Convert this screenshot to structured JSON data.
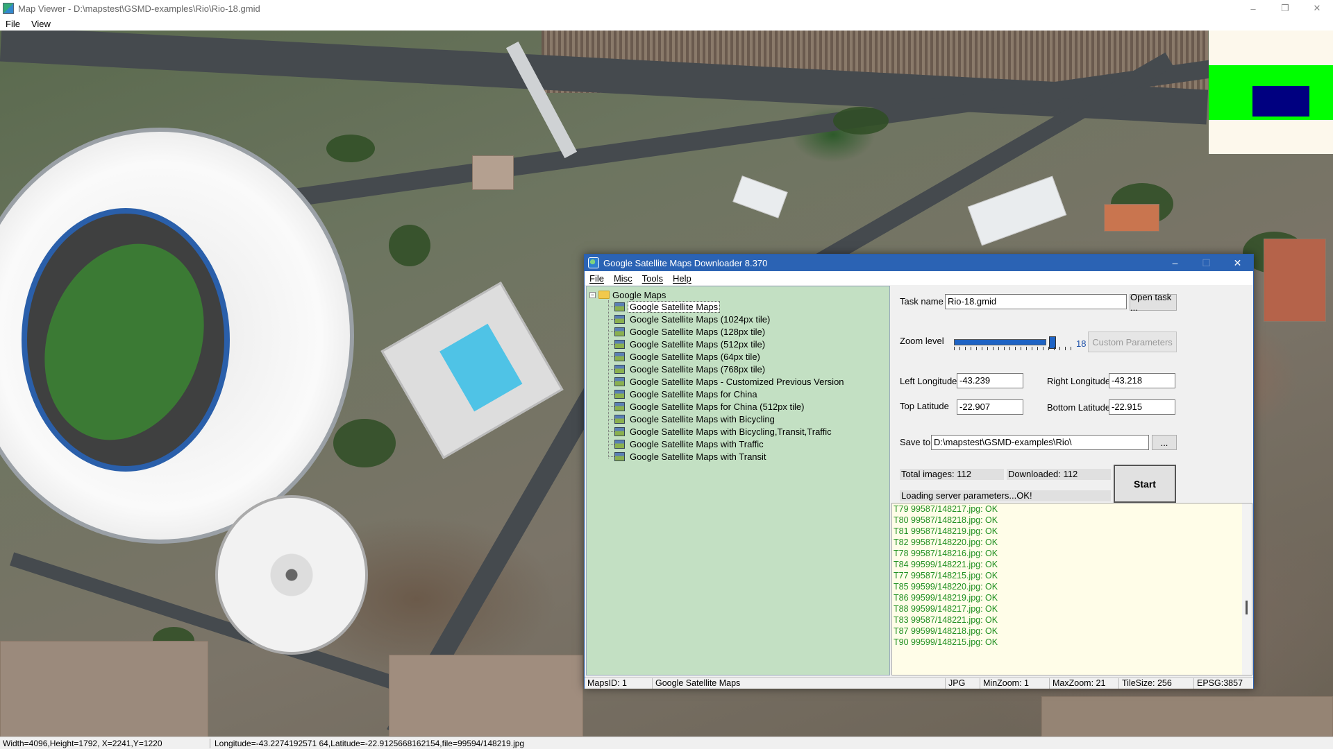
{
  "map_viewer": {
    "title": "Map Viewer - D:\\mapstest\\GSMD-examples\\Rio\\Rio-18.gmid",
    "menu": [
      "File",
      "View"
    ],
    "window_buttons": [
      "–",
      "❐",
      "✕"
    ],
    "status": {
      "dims": "Width=4096,Height=1792, X=2241,Y=1220",
      "coords": "Longitude=-43.2274192571 64,Latitude=-22.9125668162154,file=99594/148219.jpg"
    }
  },
  "downloader": {
    "title": "Google Satellite Maps Downloader 8.370",
    "window_buttons": [
      "–",
      "☐",
      "✕"
    ],
    "menu": [
      "File",
      "Misc",
      "Tools",
      "Help"
    ],
    "tree": {
      "root_label": "Google Maps",
      "items": [
        "Google Satellite Maps",
        "Google Satellite Maps (1024px tile)",
        "Google Satellite Maps (128px tile)",
        "Google Satellite Maps (512px tile)",
        "Google Satellite Maps (64px tile)",
        "Google Satellite Maps (768px tile)",
        "Google Satellite Maps - Customized Previous Version",
        "Google Satellite Maps for China",
        "Google Satellite Maps for China (512px tile)",
        "Google Satellite Maps with Bicycling",
        "Google Satellite Maps with Bicycling,Transit,Traffic",
        "Google Satellite Maps with Traffic",
        "Google Satellite Maps with Transit"
      ],
      "selected_index": 0
    },
    "form": {
      "task_name_label": "Task name",
      "task_name_value": "Rio-18.gmid",
      "open_task_label": "Open task ...",
      "zoom_label": "Zoom level",
      "zoom_value": "18",
      "zoom_fraction": 0.857,
      "custom_params_label": "Custom Parameters",
      "left_lon_label": "Left Longitude",
      "left_lon_value": "-43.239",
      "right_lon_label": "Right Longitude",
      "right_lon_value": "-43.218",
      "top_lat_label": "Top Latitude",
      "top_lat_value": "-22.907",
      "bottom_lat_label": "Bottom Latitude",
      "bottom_lat_value": "-22.915",
      "save_to_label": "Save to",
      "save_to_value": "D:\\mapstest\\GSMD-examples\\Rio\\",
      "browse_label": "...",
      "total_images": "Total images: 112",
      "downloaded": "Downloaded: 112",
      "server_status": "Loading server parameters...OK!",
      "start_label": "Start"
    },
    "log": [
      "T79 99587/148217.jpg: OK",
      "T80 99587/148218.jpg: OK",
      "T81 99587/148219.jpg: OK",
      "T82 99587/148220.jpg: OK",
      "T78 99587/148216.jpg: OK",
      "T84 99599/148221.jpg: OK",
      "T77 99587/148215.jpg: OK",
      "T85 99599/148220.jpg: OK",
      "T86 99599/148219.jpg: OK",
      "T88 99599/148217.jpg: OK",
      "T83 99587/148221.jpg: OK",
      "T87 99599/148218.jpg: OK",
      "T90 99599/148215.jpg: OK"
    ],
    "statusbar": {
      "maps_id": "MapsID: 1",
      "map_name": "Google Satellite Maps",
      "format": "JPG",
      "min_zoom": "MinZoom: 1",
      "max_zoom": "MaxZoom: 21",
      "tile_size": "TileSize: 256",
      "epsg": "EPSG:3857"
    }
  },
  "colors": {
    "downloader_titlebar": "#2b63b4",
    "tree_bg": "#c3e0c3",
    "log_text": "#1f8f1f",
    "log_bg": "#fffde8",
    "overview_green": "#00ff00",
    "overview_blue": "#000080"
  }
}
